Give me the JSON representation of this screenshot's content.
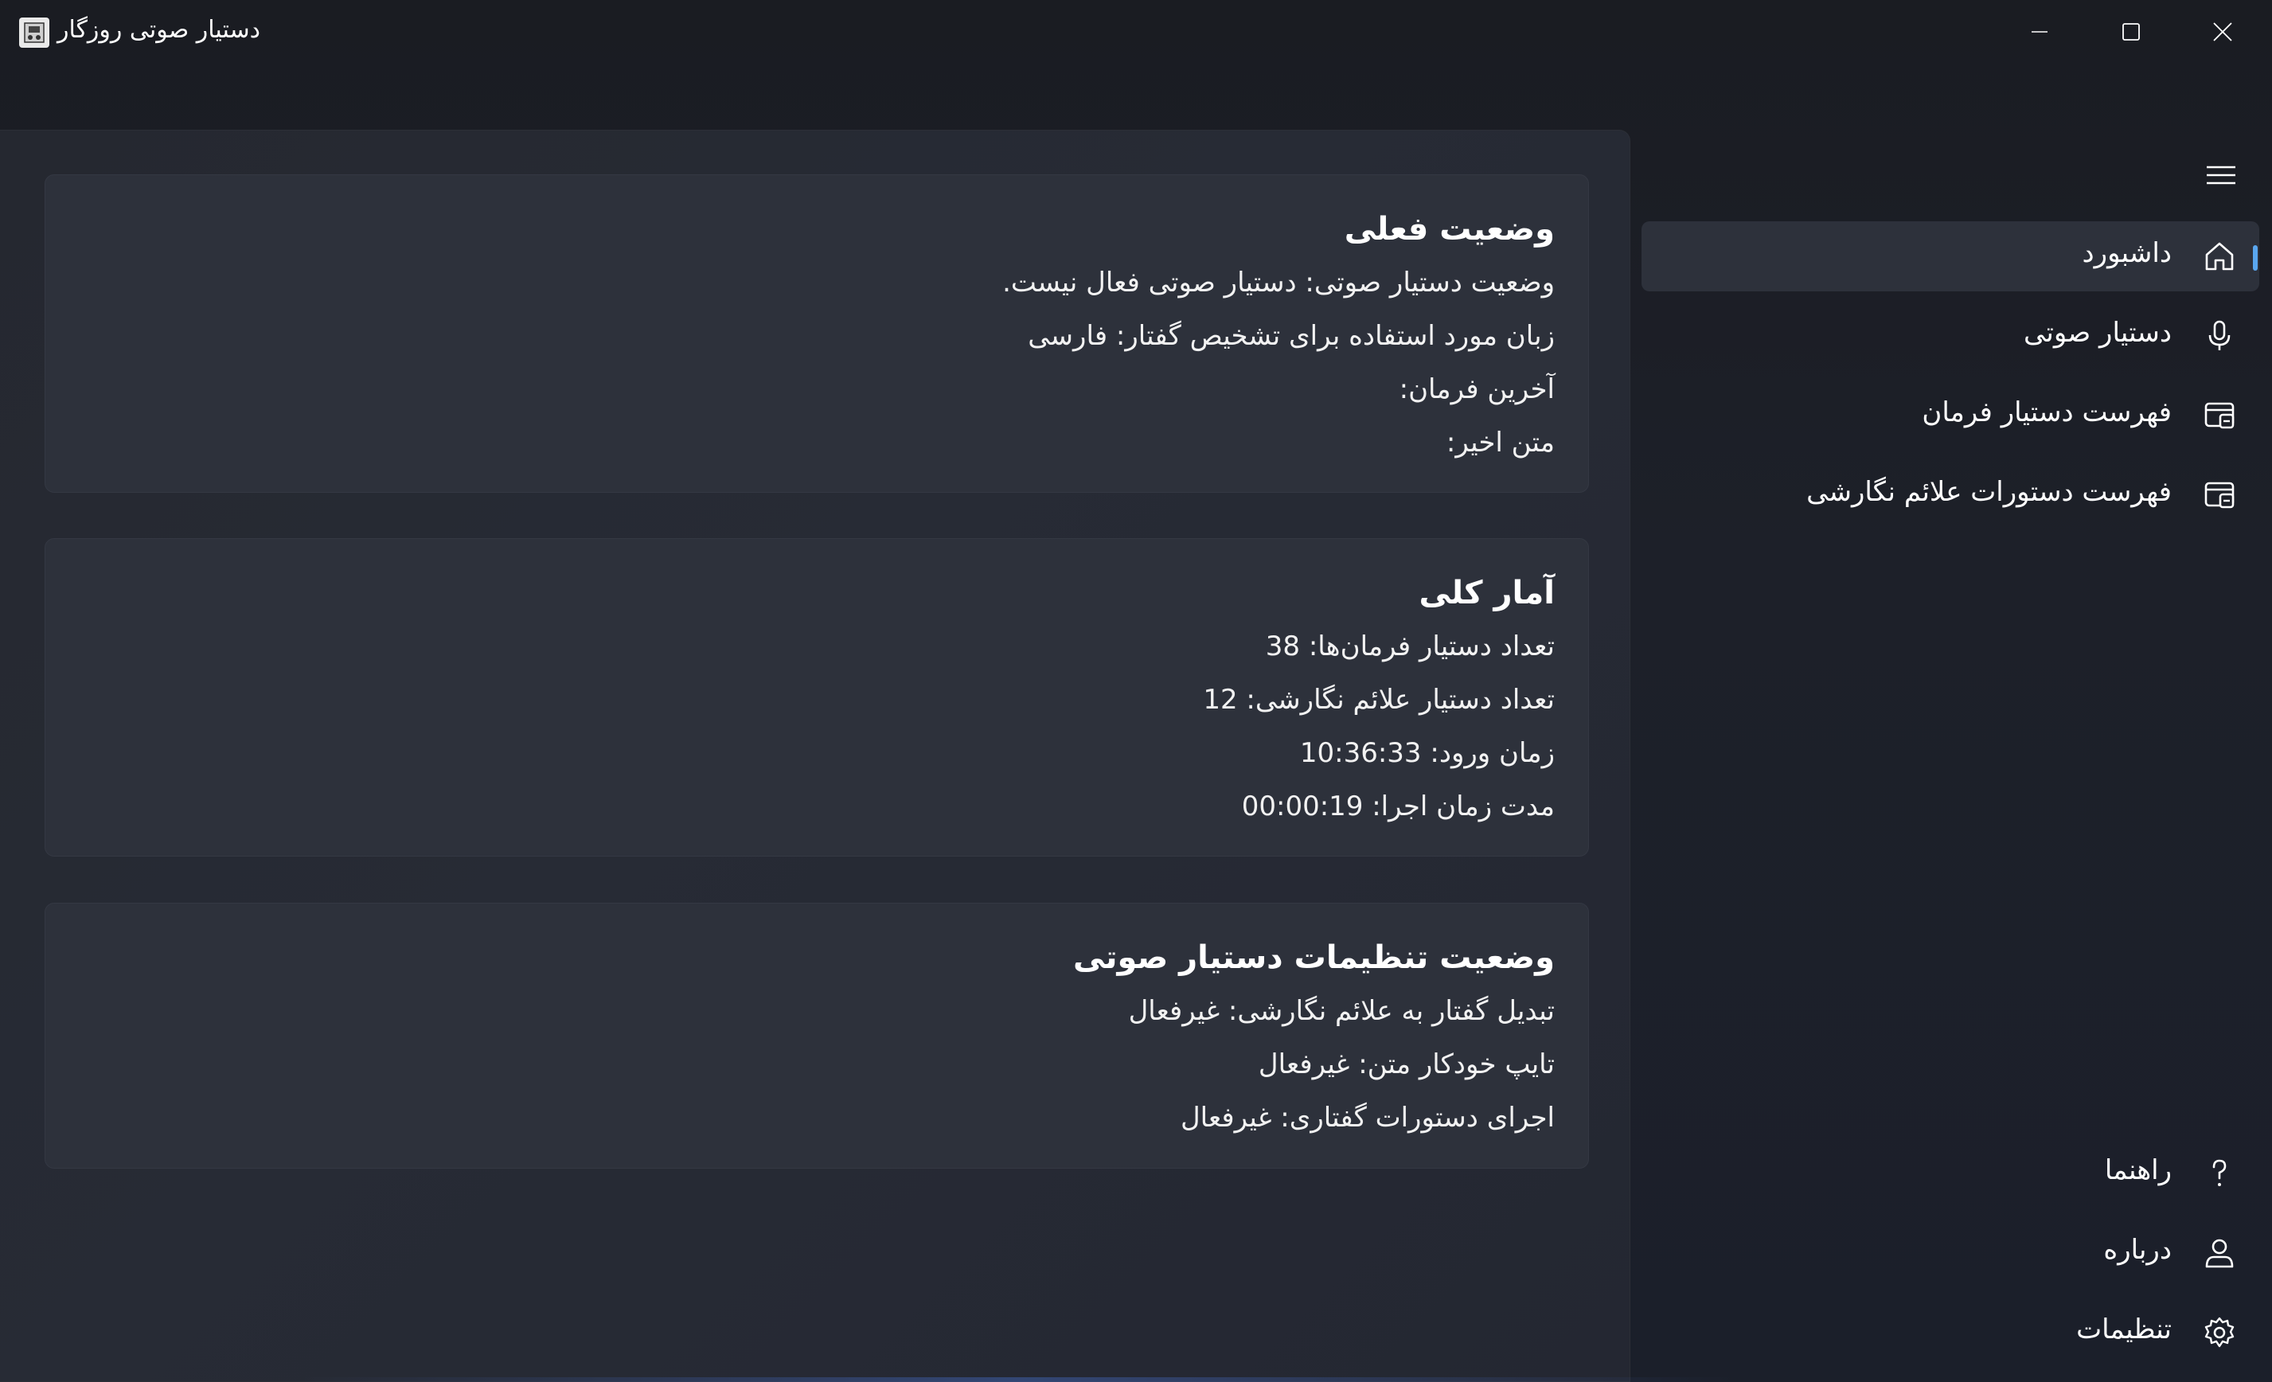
{
  "window": {
    "title": "دستیار صوتی روزگار",
    "icon": "app-logo-icon"
  },
  "title_bar_controls": {
    "minimize": "minimize-icon",
    "maximize": "maximize-icon",
    "close": "close-icon"
  },
  "sidebar": {
    "menu_icon": "hamburger-menu-icon",
    "items": [
      {
        "label": "داشبورد",
        "icon": "home-icon",
        "selected": true
      },
      {
        "label": "دستیار صوتی",
        "icon": "microphone-icon",
        "selected": false
      },
      {
        "label": "فهرست دستیار فرمان",
        "icon": "command-list-icon",
        "selected": false
      },
      {
        "label": "فهرست دستورات علائم نگارشی",
        "icon": "punctuation-list-icon",
        "selected": false
      }
    ],
    "footer_items": [
      {
        "label": "راهنما",
        "icon": "help-icon"
      },
      {
        "label": "درباره",
        "icon": "person-icon"
      },
      {
        "label": "تنظیمات",
        "icon": "gear-icon"
      }
    ],
    "accent_color": "#5aa7f0"
  },
  "cards": {
    "current_status": {
      "title": "وضعیت فعلی",
      "lines": [
        "وضعیت دستیار صوتی: دستیار صوتی فعال نیست.",
        "زبان مورد استفاده برای تشخیص گفتار: فارسی",
        "آخرین فرمان:",
        "متن اخیر:"
      ]
    },
    "overall_stats": {
      "title": "آمار کلی",
      "lines": [
        "تعداد دستیار فرمان‌ها: 38",
        "تعداد دستیار علائم نگارشی:  12",
        "زمان ورود:  10:36:33",
        "مدت زمان اجرا: 00:00:19"
      ]
    },
    "settings_status": {
      "title": "وضعیت تنظیمات دستیار صوتی",
      "lines": [
        "تبدیل گفتار به علائم نگارشی: غیرفعال",
        "تایپ خودکار متن: غیرفعال",
        "اجرای دستورات گفتاری: غیرفعال"
      ]
    }
  }
}
